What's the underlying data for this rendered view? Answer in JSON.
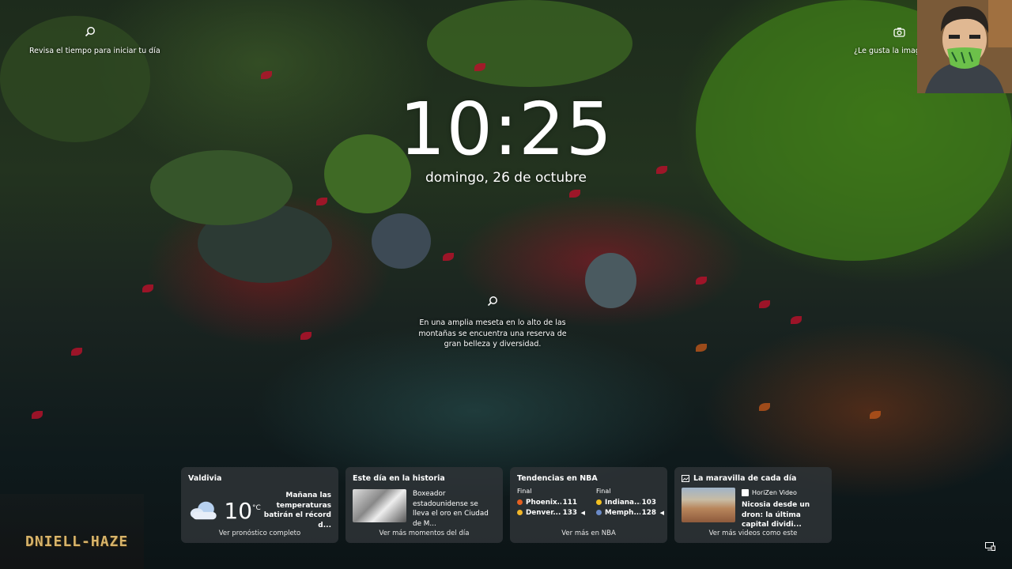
{
  "top_left": {
    "label": "Revisa el tiempo para iniciar tu día",
    "icon": "search-icon"
  },
  "top_right": {
    "label": "¿Le gusta la imagen?",
    "icon": "camera-icon"
  },
  "lockscreen": {
    "time": "10:25",
    "date": "domingo, 26 de octubre"
  },
  "image_caption": {
    "icon": "search-icon",
    "text": "En una amplia meseta en lo alto de las montañas se encuentra una reserva de gran belleza y diversidad."
  },
  "watermark": {
    "logo_text": "DNIELL-HAZE"
  },
  "widgets": {
    "weather": {
      "title": "Valdivia",
      "temp": "10",
      "unit": "°C",
      "icon": "cloud-icon",
      "headline": "Mañana las temperaturas batirán el récord d...",
      "footer": "Ver pronóstico completo"
    },
    "history": {
      "title": "Este día en la historia",
      "text": "Boxeador estadounidense se lleva el oro en Ciudad de M...",
      "footer": "Ver más momentos del día"
    },
    "nba": {
      "title": "Tendencias en NBA",
      "games": [
        {
          "status": "Final",
          "team1": "Phoenix...",
          "score1": "111",
          "team2": "Denver...",
          "score2": "133"
        },
        {
          "status": "Final",
          "team1": "Indiana...",
          "score1": "103",
          "team2": "Memph...",
          "score2": "128"
        }
      ],
      "footer": "Ver más en NBA"
    },
    "video": {
      "title": "La maravilla de cada día",
      "source": "HoriZen Video",
      "headline": "Nicosia desde un dron: la última capital dividi...",
      "footer": "Ver más videos como este"
    }
  },
  "colors": {
    "widget_bg": "#303438",
    "logo": "#d8b46a",
    "leaf_red": "#b3122a",
    "moss": "#4a7a1e"
  }
}
